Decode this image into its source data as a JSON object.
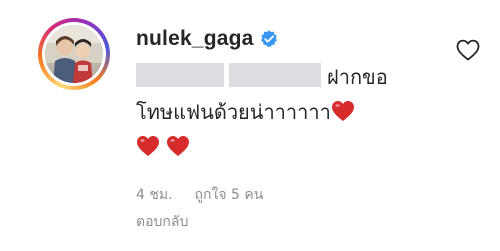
{
  "comment": {
    "username": "nulek_gaga",
    "verified_icon": "verified-badge-icon",
    "text_line1": "ฝากขอ",
    "text_line2": "โทษแฟนด้วยน่าาาาาา",
    "time": "4 ชม.",
    "likes": "ถูกใจ 5 คน",
    "reply_label": "ตอบกลับ",
    "like_icon": "heart-outline-icon",
    "heart_emoji_color": "#d62b2b",
    "verified_color": "#3897f0"
  }
}
